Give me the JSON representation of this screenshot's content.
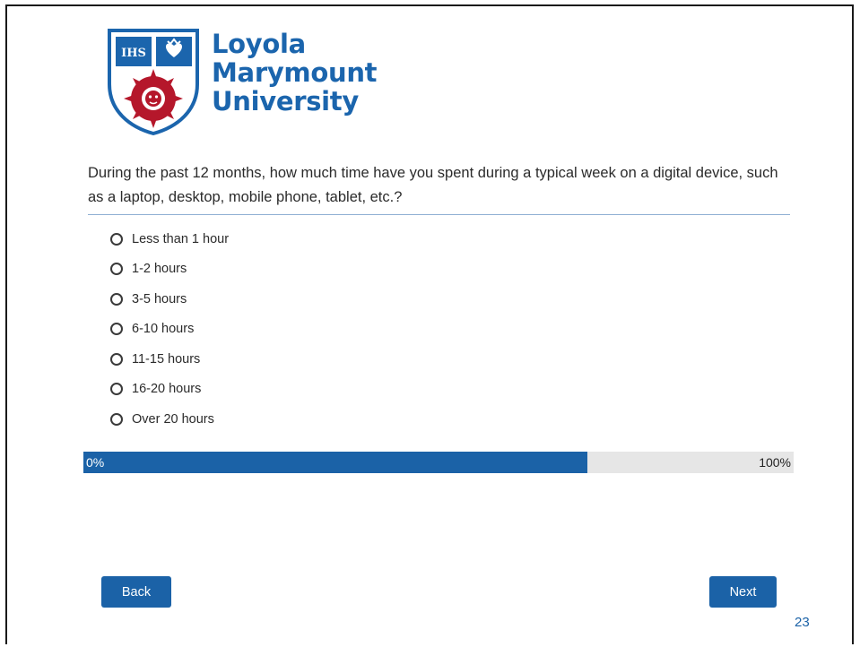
{
  "brand": {
    "name_line1": "Loyola",
    "name_line2": "Marymount",
    "name_line3": "University",
    "color": "#1b65ad",
    "accent_red": "#b5172b"
  },
  "survey": {
    "question": "During the past 12 months, how much time have you spent during a typical week on a digital device, such as a laptop, desktop, mobile phone, tablet, etc.?",
    "options": [
      "Less than 1 hour",
      "1-2 hours",
      "3-5 hours",
      "6-10 hours",
      "11-15 hours",
      "16-20 hours",
      "Over 20 hours"
    ],
    "selected": null
  },
  "progress": {
    "start_label": "0%",
    "end_label": "100%",
    "fraction": 0.71,
    "fill_color": "#1b62a7"
  },
  "nav": {
    "back_label": "Back",
    "next_label": "Next"
  },
  "slide_number": "23"
}
